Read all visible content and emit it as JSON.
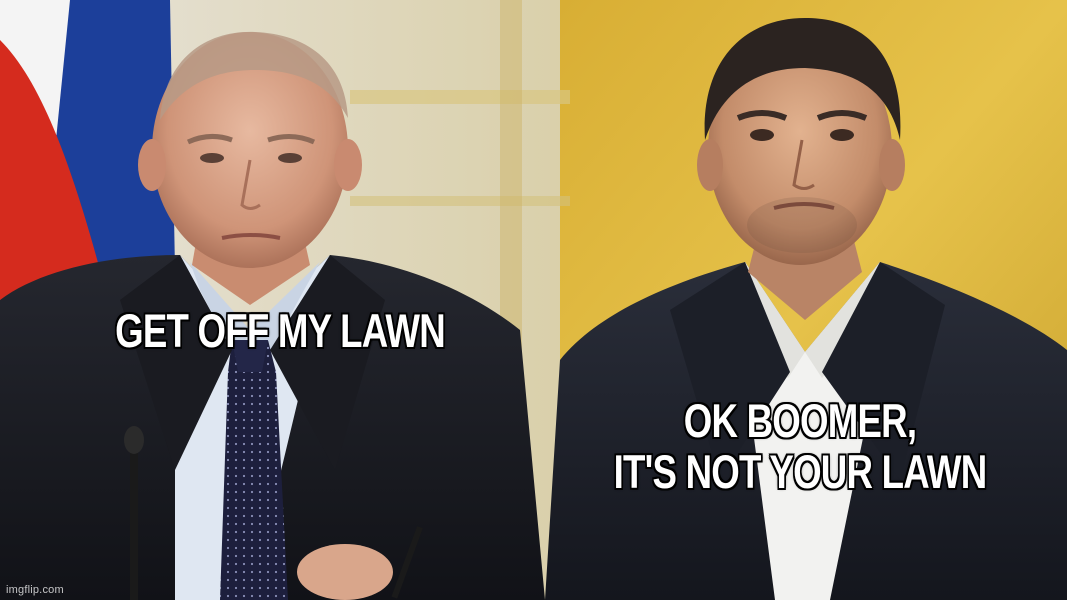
{
  "meme": {
    "caption_left": "GET OFF MY LAWN",
    "caption_right_line1": "OK BOOMER,",
    "caption_right_line2": "IT'S NOT YOUR LAWN",
    "watermark": "imgflip.com"
  },
  "colors": {
    "flag_red": "#d52b1e",
    "flag_blue": "#1c3f9a",
    "flag_white": "#f4f4f4",
    "yellow_background": "#e0b83a",
    "suit_dark": "#1b1c22",
    "caption_text": "#ffffff",
    "caption_outline": "#000000"
  }
}
